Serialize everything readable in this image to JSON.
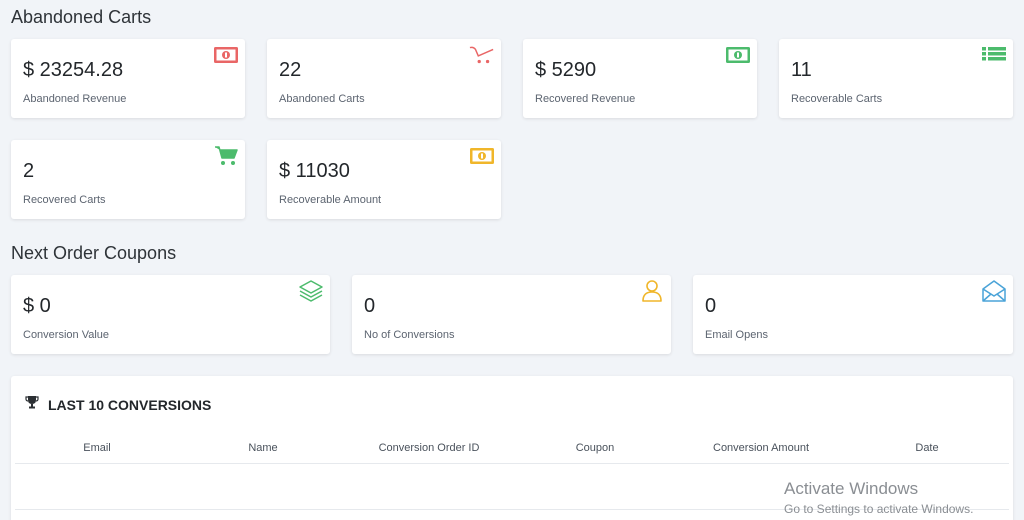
{
  "sections": {
    "abandoned_carts": "Abandoned Carts",
    "next_order_coupons": "Next Order Coupons"
  },
  "abandoned_cards": [
    {
      "value": "$ 23254.28",
      "label": "Abandoned Revenue",
      "icon": "money-icon",
      "color": "#e96666"
    },
    {
      "value": "22",
      "label": "Abandoned Carts",
      "icon": "cart-outline-icon",
      "color": "#e96666"
    },
    {
      "value": "$ 5290",
      "label": "Recovered Revenue",
      "icon": "money-icon",
      "color": "#4cbb6c"
    },
    {
      "value": "11",
      "label": "Recoverable Carts",
      "icon": "list-icon",
      "color": "#4cbb6c"
    },
    {
      "value": "2",
      "label": "Recovered Carts",
      "icon": "cart-icon",
      "color": "#4cbb6c"
    },
    {
      "value": "$ 11030",
      "label": "Recoverable Amount",
      "icon": "money-icon",
      "color": "#f0b62a"
    }
  ],
  "coupon_cards": [
    {
      "value": "$ 0",
      "label": "Conversion Value",
      "icon": "layers-icon",
      "color": "#4cbb6c"
    },
    {
      "value": "0",
      "label": "No of Conversions",
      "icon": "user-icon",
      "color": "#f0b62a"
    },
    {
      "value": "0",
      "label": "Email Opens",
      "icon": "envelope-open-icon",
      "color": "#4aa3d8"
    }
  ],
  "conversions": {
    "title": "LAST 10 CONVERSIONS",
    "icon": "trophy-icon",
    "columns": [
      "Email",
      "Name",
      "Conversion Order ID",
      "Coupon",
      "Conversion Amount",
      "Date"
    ],
    "rows": []
  },
  "watermark": {
    "line1": "Activate Windows",
    "line2": "Go to Settings to activate Windows."
  }
}
